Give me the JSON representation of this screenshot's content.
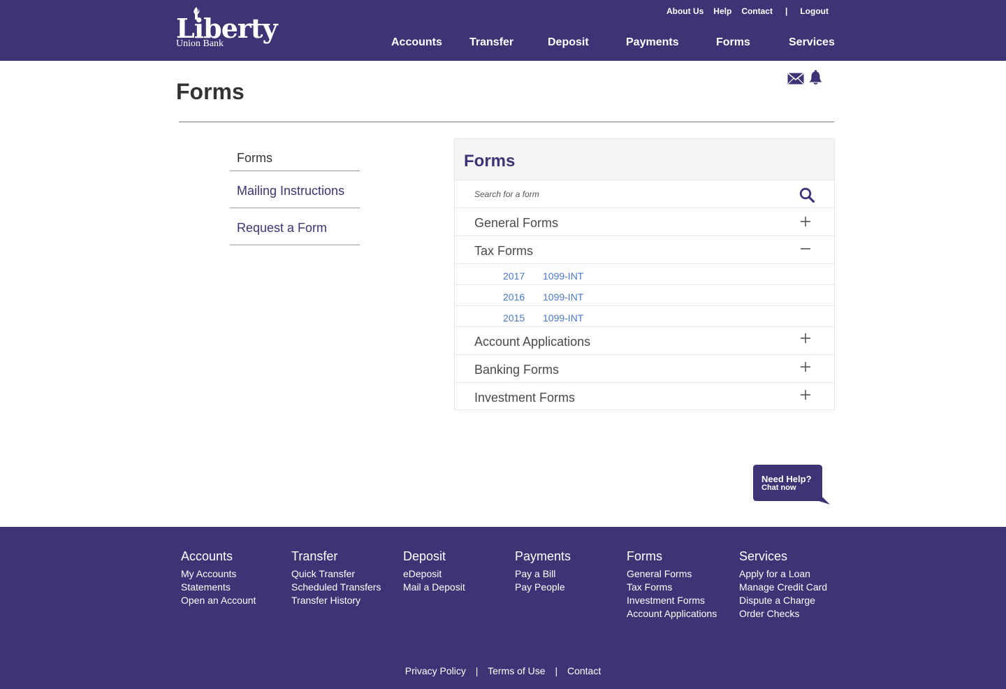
{
  "brand": {
    "logo_text": "Liberty",
    "logo_sub": "Union Bank",
    "primary_color": "#3f3376",
    "link_color": "#4a78c9"
  },
  "top_links": [
    {
      "label": "About Us"
    },
    {
      "label": "Help"
    },
    {
      "label": "Contact"
    }
  ],
  "top_separator": "|",
  "logout_label": "Logout",
  "main_nav": [
    {
      "label": "Accounts"
    },
    {
      "label": "Transfer"
    },
    {
      "label": "Deposit"
    },
    {
      "label": "Payments"
    },
    {
      "label": "Forms"
    },
    {
      "label": "Services"
    }
  ],
  "page": {
    "title": "Forms",
    "icons": [
      "envelope-icon",
      "bell-icon"
    ]
  },
  "side_menu": [
    {
      "label": "Forms",
      "active": true
    },
    {
      "label": "Mailing Instructions",
      "active": false
    },
    {
      "label": "Request a Form",
      "active": false
    }
  ],
  "panel": {
    "title": "Forms",
    "search_placeholder": "Search for a form",
    "sections": [
      {
        "label": "General Forms",
        "expanded": false
      },
      {
        "label": "Tax Forms",
        "expanded": true,
        "items": [
          {
            "year": "2017",
            "form": "1099-INT"
          },
          {
            "year": "2016",
            "form": "1099-INT"
          },
          {
            "year": "2015",
            "form": "1099-INT"
          }
        ]
      },
      {
        "label": "Account Applications",
        "expanded": false
      },
      {
        "label": "Banking Forms",
        "expanded": false
      },
      {
        "label": "Investment Forms",
        "expanded": false
      }
    ]
  },
  "need_help": {
    "line1": "Need Help?",
    "line2": "Chat now"
  },
  "footer": {
    "columns": [
      {
        "heading": "Accounts",
        "links": [
          "My Accounts",
          "Statements",
          "Open an Account"
        ]
      },
      {
        "heading": "Transfer",
        "links": [
          "Quick Transfer",
          "Scheduled Transfers",
          "Transfer History"
        ]
      },
      {
        "heading": "Deposit",
        "links": [
          "eDeposit",
          "Mail a Deposit"
        ]
      },
      {
        "heading": "Payments",
        "links": [
          "Pay a Bill",
          "Pay People"
        ]
      },
      {
        "heading": "Forms",
        "links": [
          "General Forms",
          "Tax Forms",
          "Investment Forms",
          "Account Applications"
        ]
      },
      {
        "heading": "Services",
        "links": [
          "Apply for a Loan",
          "Manage Credit Card",
          "Dispute a Charge",
          "Order Checks"
        ]
      }
    ],
    "legal": [
      {
        "label": "Privacy Policy"
      },
      {
        "label": "Terms of Use"
      },
      {
        "label": "Contact"
      }
    ],
    "legal_separator": "|"
  }
}
